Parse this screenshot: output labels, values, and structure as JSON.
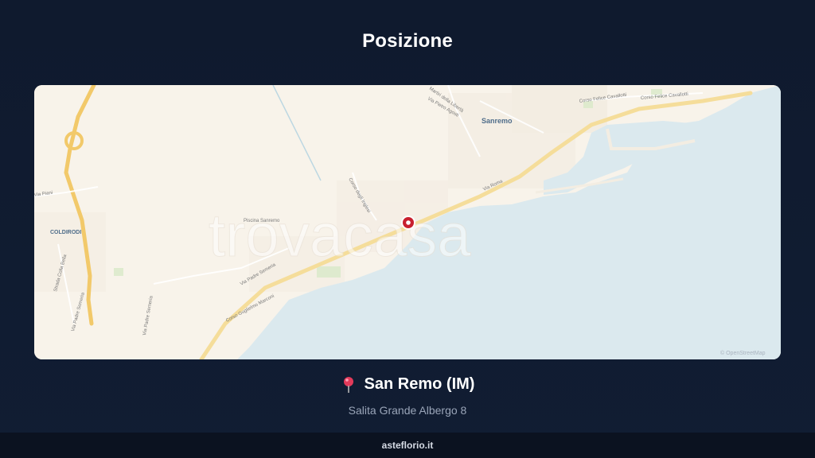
{
  "header": {
    "title": "Posizione"
  },
  "map": {
    "labels": {
      "sanremo": "Sanremo",
      "coldirodi": "COLDIRODI",
      "corso_felice_cavallotti_1": "Corso Felice Cavallotti",
      "corso_felice_cavallotti_2": "Corso Felice Cavallotti",
      "martiri_liberta": "Martiri della Libertà",
      "via_pietro_agosti": "Via Pietro Agosti",
      "via_roma": "Via Roma",
      "corso_inglesi": "Corso degli Inglesi",
      "piscina_sanremo": "Piscina Sanremo",
      "via_padre_semeria_1": "Via Padre Semeria",
      "via_padre_semeria_2": "Via Padre Semeria",
      "via_padre_semeria_3": "Via Padre Semeria",
      "corso_guglielmo_marconi": "Corso Guglielmo Marconi",
      "strada_colla_bella": "Strada Colla Bella",
      "via_pian": "Via Piani"
    },
    "watermark": "trovacasa",
    "attribution": "© OpenStreetMap",
    "colors": {
      "land": "#f8f3ea",
      "sea": "#dbe9ee",
      "road_main": "#f5dd9a",
      "marker": "#c8202e"
    }
  },
  "location": {
    "city": "San Remo (IM)",
    "address": "Salita Grande Albergo 8",
    "icon": "map-pin-icon"
  },
  "footer": {
    "site": "asteflorio.it"
  }
}
